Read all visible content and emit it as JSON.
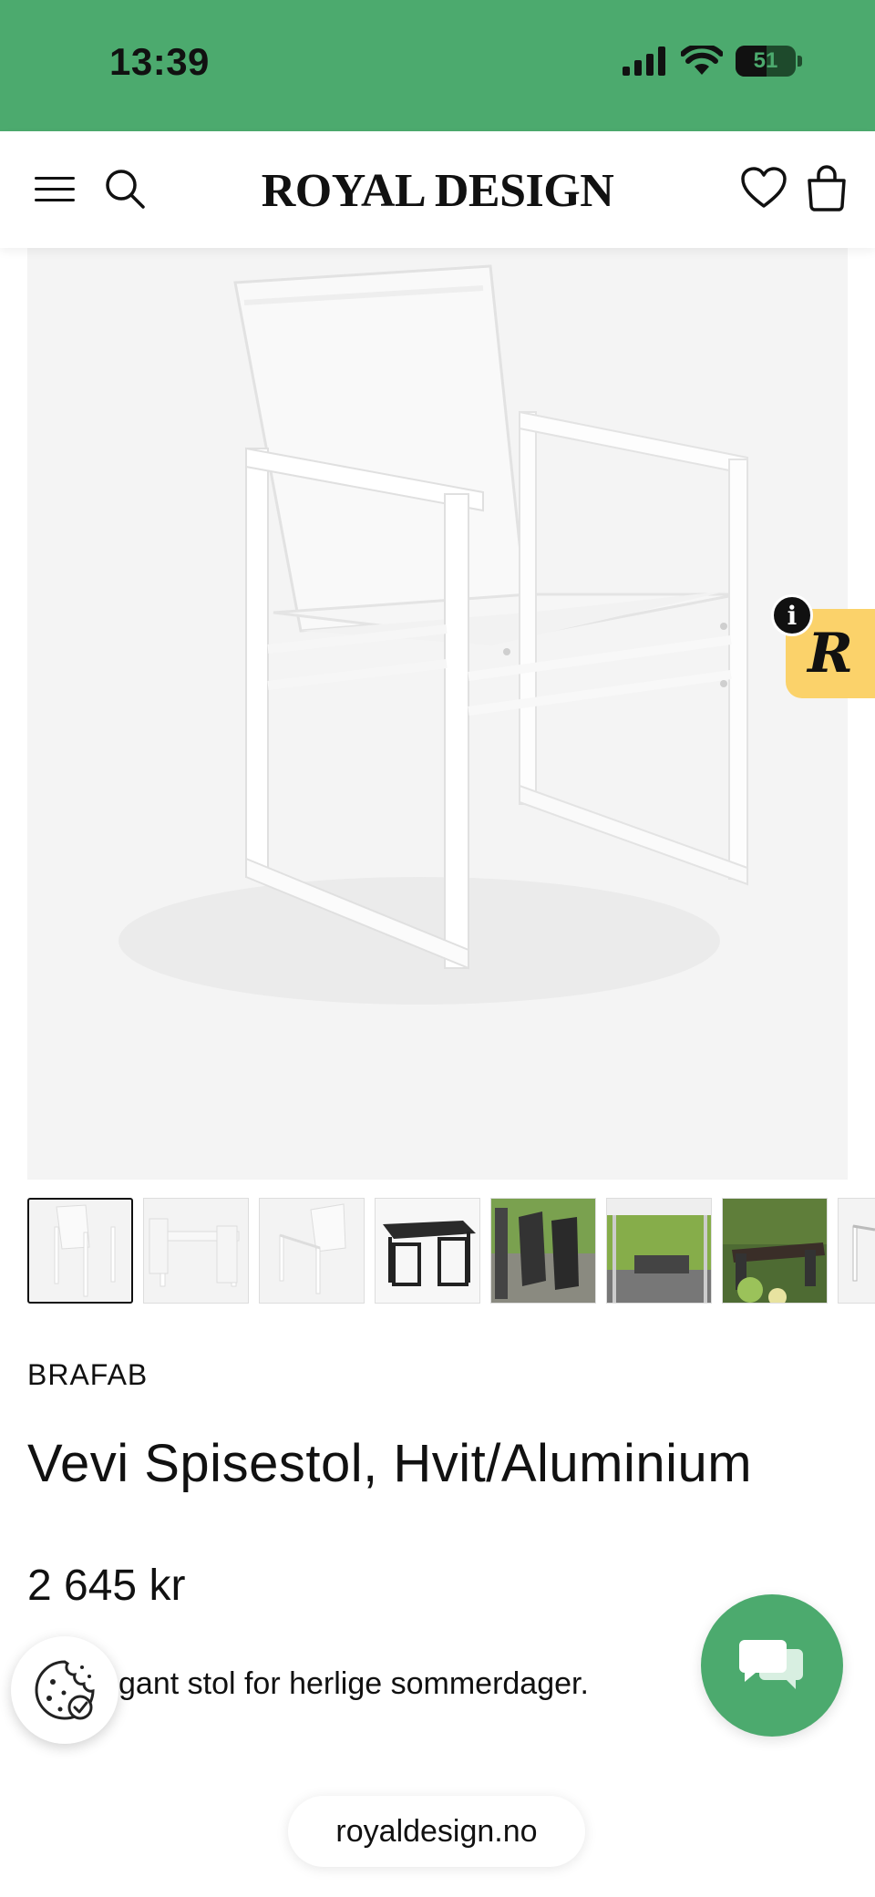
{
  "status_bar": {
    "time": "13:39",
    "battery_level": "51",
    "battery_fraction": 0.51
  },
  "header": {
    "brand": "ROYAL DESIGN",
    "icons": [
      "menu-icon",
      "search-icon",
      "heart-icon",
      "shopping-bag-icon"
    ]
  },
  "product": {
    "brand": "BRAFAB",
    "title": "Vevi Spisestol, Hvit/Aluminium",
    "price": "2 645 kr",
    "description": "gant stol for herlige sommerdager."
  },
  "gallery": {
    "thumbnail_count": 8,
    "active_index": 0
  },
  "widgets": {
    "review_badge_letter": "R",
    "info_letter": "i"
  },
  "browser": {
    "url": "royaldesign.no"
  },
  "colors": {
    "status_bar": "#4caa6e",
    "chat_button": "#4caa6e",
    "review_badge": "#fbd26a",
    "image_background": "#f4f4f4"
  }
}
